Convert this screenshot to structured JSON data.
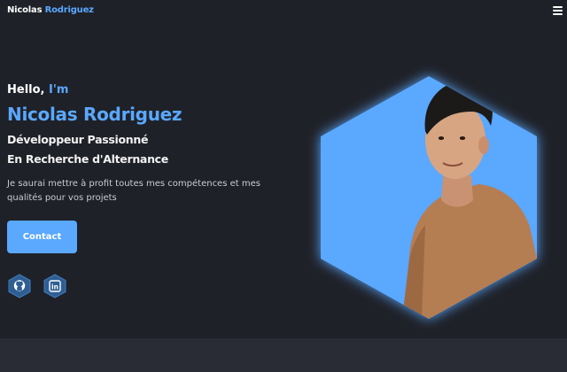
{
  "nav": {
    "brand_first": "Nicolas",
    "brand_second": "Rodriguez",
    "menu_icon": "hamburger-menu-icon"
  },
  "hero": {
    "hello_prefix": "Hello,",
    "hello_accent": "I'm",
    "name": "Nicolas Rodriguez",
    "role_line1": "Développeur Passionné",
    "role_line2": "En Recherche d'Alternance",
    "description": "Je saurai mettre à profit toutes mes compétences et mes qualités pour vos projets",
    "contact_label": "Contact"
  },
  "social": {
    "github_icon": "github-icon",
    "linkedin_icon": "linkedin-icon",
    "linkedin_text": "in"
  },
  "colors": {
    "background": "#1f2128",
    "accent": "#5aa8ff",
    "text": "#ffffff",
    "muted_text": "#c9ccd2",
    "bottom_band": "#292c35"
  }
}
